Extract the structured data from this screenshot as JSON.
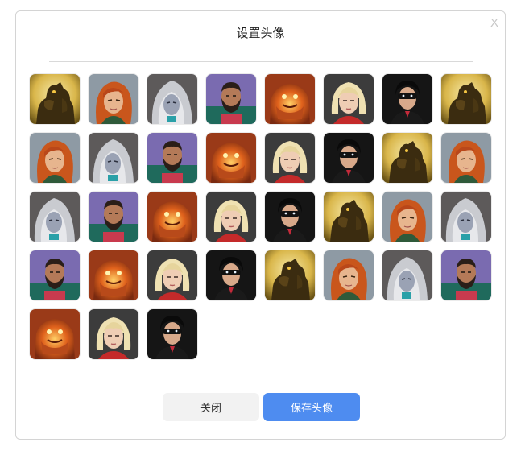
{
  "dialog": {
    "title": "设置头像",
    "close_glyph": "X",
    "close_button_label": "关闭",
    "save_button_label": "保存头像"
  },
  "avatar_sequence": [
    "golem",
    "redhair",
    "ghost",
    "bearded",
    "lava",
    "blonde",
    "masked"
  ],
  "avatar_count": 35,
  "colors": {
    "accent": "#4e8cf0",
    "secondary_button": "#f2f2f2"
  }
}
